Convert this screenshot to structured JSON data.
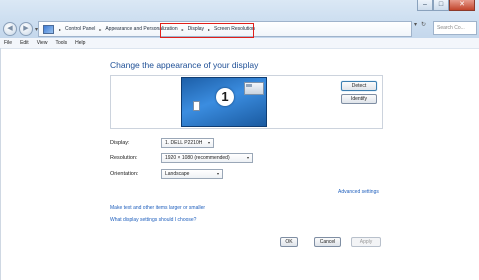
{
  "window": {
    "controls": {
      "minimize": "–",
      "maximize": "□",
      "close": "✕"
    }
  },
  "nav": {
    "back_icon": "back-arrow-icon",
    "forward_icon": "forward-arrow-icon",
    "back_symbol": "◀",
    "forward_symbol": "▶",
    "dropdown_symbol": "▾"
  },
  "address": {
    "icon": "control-panel-icon",
    "separator": "▸",
    "crumbs": [
      "Control Panel",
      "Appearance and Personalization",
      "Display",
      "Screen Resolution"
    ],
    "dropdown_symbol": "▾",
    "refresh_symbol": "↻"
  },
  "search": {
    "placeholder": "Search Co..."
  },
  "menu": [
    "File",
    "Edit",
    "View",
    "Tools",
    "Help"
  ],
  "main": {
    "title": "Change the appearance of your display",
    "monitor_number": "1",
    "detect_label": "Detect",
    "identify_label": "Identify",
    "fields": [
      {
        "label": "Display:",
        "value": "1. DELL P2210H"
      },
      {
        "label": "Resolution:",
        "value": "1920 × 1080 (recommended)"
      },
      {
        "label": "Orientation:",
        "value": "Landscape"
      }
    ],
    "select_arrow": "▾",
    "advanced_link": "Advanced settings",
    "links": [
      "Make text and other items larger or smaller",
      "What display settings should I choose?"
    ],
    "ok_label": "OK",
    "cancel_label": "Cancel",
    "apply_label": "Apply"
  },
  "colors": {
    "accent_link": "#1f5fbd",
    "title": "#1e4f96",
    "highlight": "#e0201b"
  }
}
